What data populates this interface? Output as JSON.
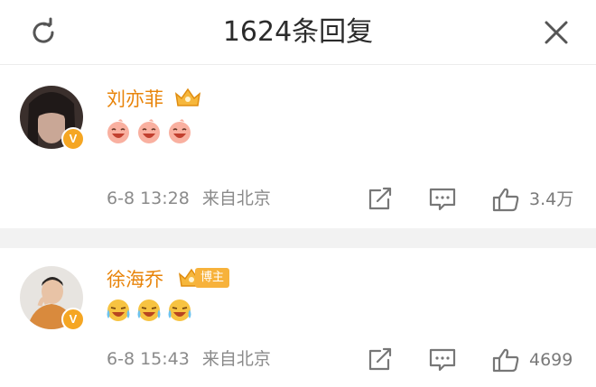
{
  "header": {
    "title": "1624条回复",
    "left_icon": "refresh-icon",
    "right_icon": "close-icon"
  },
  "comments": [
    {
      "username": "刘亦菲",
      "verified_badge": "V",
      "crown_icon": "crown-icon",
      "emojis": [
        "laughing-emoji",
        "laughing-emoji",
        "laughing-emoji"
      ],
      "date": "6-8 13:28",
      "location": "来自北京",
      "likes": "3.4万"
    },
    {
      "username": "徐海乔",
      "verified_badge": "V",
      "crown_icon": "crown-icon",
      "tag": "博主",
      "emojis": [
        "crying-laughing-emoji",
        "crying-laughing-emoji",
        "crying-laughing-emoji"
      ],
      "date": "6-8 15:43",
      "location": "来自北京",
      "likes": "4699"
    }
  ],
  "colors": {
    "username": "#e8840a",
    "meta": "#8a8a8a",
    "badge": "#f5a623",
    "separator": "#f2f2f2"
  }
}
